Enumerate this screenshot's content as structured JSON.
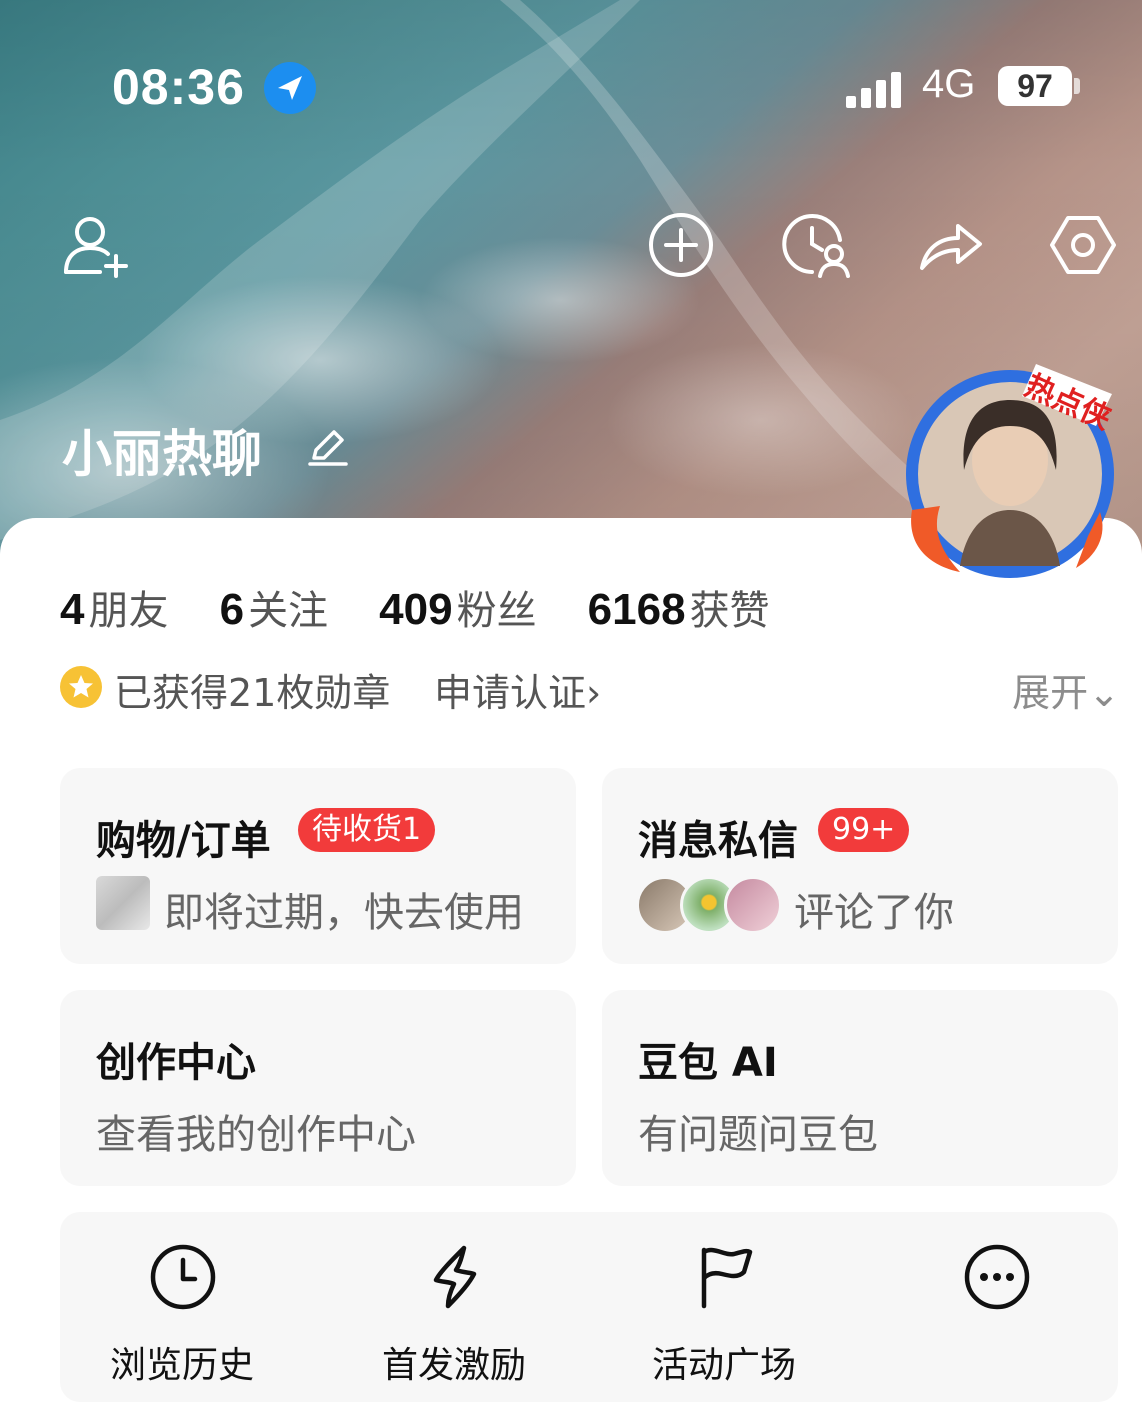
{
  "status_bar": {
    "time": "08:36",
    "network": "4G",
    "battery": "97"
  },
  "profile": {
    "name": "小丽热聊",
    "avatar_badge": "热点侠"
  },
  "stats": [
    {
      "num": "4",
      "label": "朋友"
    },
    {
      "num": "6",
      "label": "关注"
    },
    {
      "num": "409",
      "label": "粉丝"
    },
    {
      "num": "6168",
      "label": "获赞"
    }
  ],
  "badges": {
    "medals": "已获得21枚勋章",
    "verify": "申请认证›",
    "expand": "展开⌄"
  },
  "cards": {
    "shopping": {
      "title": "购物/订单",
      "pill": "待收货1",
      "sub": "即将过期，快去使用"
    },
    "messages": {
      "title": "消息私信",
      "pill": "99+",
      "sub": "评论了你"
    },
    "creator": {
      "title": "创作中心",
      "sub": "查看我的创作中心"
    },
    "doubao": {
      "title": "豆包 AI",
      "sub": "有问题问豆包"
    }
  },
  "tools": [
    {
      "label": "浏览历史",
      "icon": "clock-icon"
    },
    {
      "label": "首发激励",
      "icon": "lightning-icon"
    },
    {
      "label": "活动广场",
      "icon": "flag-icon"
    },
    {
      "label": "",
      "icon": "more-icon"
    }
  ],
  "colors": {
    "accent_red": "#f23b3b",
    "location_blue": "#1c8ef0",
    "medal_gold": "#f7c235"
  }
}
